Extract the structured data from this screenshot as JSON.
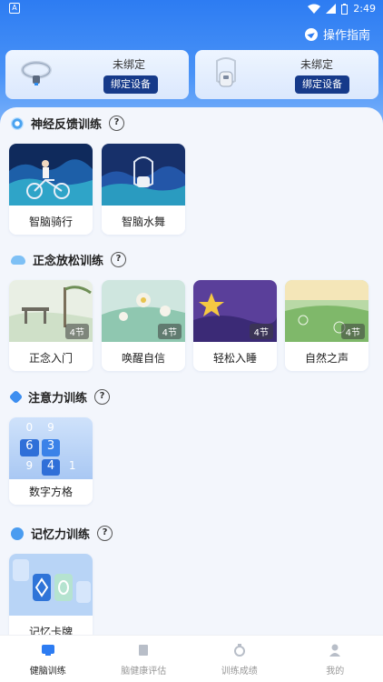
{
  "status_bar": {
    "left_icon": "A",
    "time": "2:49"
  },
  "guide": {
    "label": "操作指南"
  },
  "devices": [
    {
      "status": "未绑定",
      "button": "绑定设备",
      "image": "headband-device"
    },
    {
      "status": "未绑定",
      "button": "绑定设备",
      "image": "clip-device"
    }
  ],
  "sections": [
    {
      "title": "神经反馈训练",
      "help": "?",
      "items": [
        {
          "label": "智脑骑行"
        },
        {
          "label": "智脑水舞"
        }
      ]
    },
    {
      "title": "正念放松训练",
      "help": "?",
      "items": [
        {
          "label": "正念入门",
          "badge": "4节"
        },
        {
          "label": "唤醒自信",
          "badge": "4节"
        },
        {
          "label": "轻松入睡",
          "badge": "4节"
        },
        {
          "label": "自然之声",
          "badge": "4节"
        }
      ]
    },
    {
      "title": "注意力训练",
      "help": "?",
      "items": [
        {
          "label": "数字方格",
          "grid": [
            "0",
            "9",
            "",
            "6",
            "3",
            "",
            "9",
            "4",
            "1"
          ]
        }
      ]
    },
    {
      "title": "记忆力训练",
      "help": "?",
      "items": [
        {
          "label": "记忆卡牌"
        }
      ]
    }
  ],
  "tabs": [
    {
      "label": "健脑训练",
      "active": true
    },
    {
      "label": "脑健康评估"
    },
    {
      "label": "训练成绩"
    },
    {
      "label": "我的"
    }
  ],
  "colors": {
    "primary": "#2d7cf2",
    "bind_button": "#163a8a"
  }
}
